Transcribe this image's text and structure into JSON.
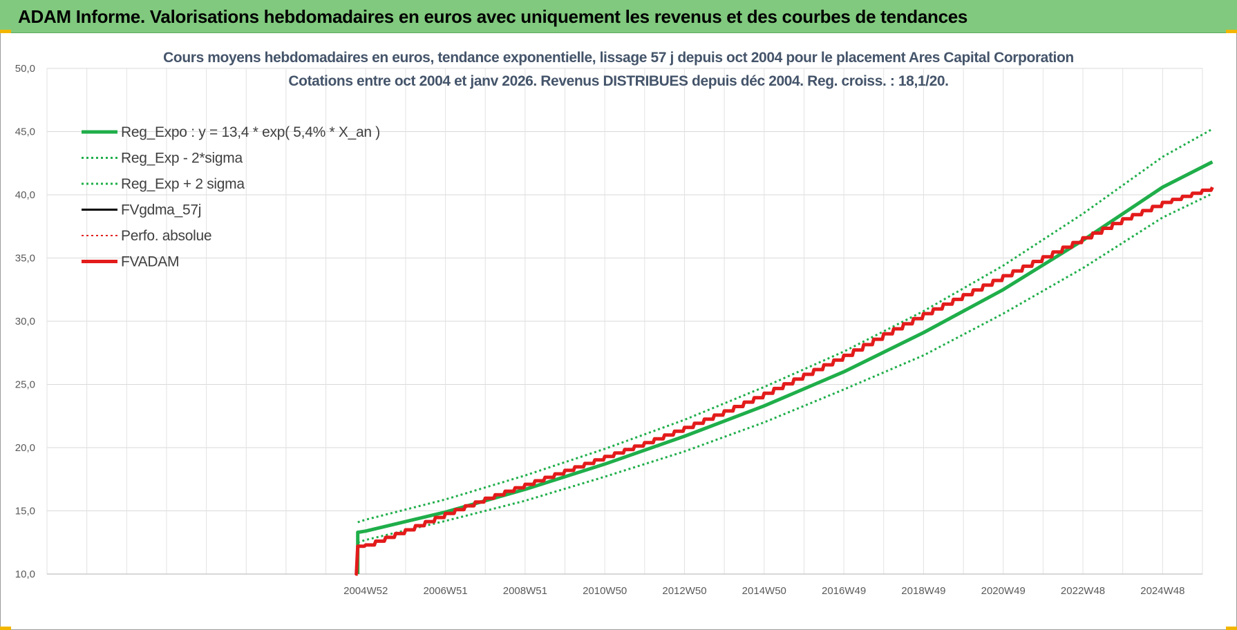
{
  "banner": {
    "title": "ADAM Informe. Valorisations hebdomadaires en euros avec uniquement les revenus et des courbes de tendances"
  },
  "chart_data": {
    "type": "line",
    "title_line1": "Cours moyens hebdomadaires en euros, tendance exponentielle, lissage 57 j depuis oct 2004 pour le placement Ares Capital Corporation",
    "title_line2": "Cotations entre oct 2004 et janv 2026. Revenus DISTRIBUES depuis déc 2004. Reg. croiss. : 18,1/20.",
    "xlabel": "",
    "ylabel": "",
    "ylim": [
      10,
      50
    ],
    "yticks": [
      10,
      15,
      20,
      25,
      30,
      35,
      40,
      45,
      50
    ],
    "ytick_labels": [
      "10,0",
      "15,0",
      "20,0",
      "25,0",
      "30,0",
      "35,0",
      "40,0",
      "45,0",
      "50,0"
    ],
    "x_category_count": 29,
    "x_tick_labels": [
      {
        "index": 8,
        "label": "2004W52"
      },
      {
        "index": 10,
        "label": "2006W51"
      },
      {
        "index": 12,
        "label": "2008W51"
      },
      {
        "index": 14,
        "label": "2010W50"
      },
      {
        "index": 16,
        "label": "2012W50"
      },
      {
        "index": 18,
        "label": "2014W50"
      },
      {
        "index": 20,
        "label": "2016W49"
      },
      {
        "index": 22,
        "label": "2018W49"
      },
      {
        "index": 24,
        "label": "2020W49"
      },
      {
        "index": 26,
        "label": "2022W48"
      },
      {
        "index": 28,
        "label": "2024W48"
      }
    ],
    "grid": true,
    "legend_position": "top-left",
    "series": [
      {
        "name": "Reg_Expo : y = 13,4 * exp( 5,4% *  X_an )",
        "color": "#1fae4a",
        "style": "solid-thick",
        "x": [
          7.8,
          7.8,
          8,
          10,
          12,
          14,
          16,
          18,
          20,
          22,
          24,
          26,
          28,
          29.25
        ],
        "y": [
          10,
          13.3,
          13.4,
          14.9,
          16.7,
          18.7,
          20.9,
          23.3,
          26.0,
          29.1,
          32.5,
          36.4,
          40.6,
          42.6
        ]
      },
      {
        "name": "Reg_Exp - 2*sigma",
        "color": "#1fae4a",
        "style": "dotted",
        "x": [
          7.8,
          8,
          10,
          12,
          14,
          16,
          18,
          20,
          22,
          24,
          26,
          28,
          29.25
        ],
        "y": [
          12.5,
          12.7,
          14.2,
          15.8,
          17.7,
          19.7,
          22.0,
          24.6,
          27.3,
          30.6,
          34.2,
          38.2,
          40.1
        ]
      },
      {
        "name": "Reg_Exp + 2 sigma",
        "color": "#1fae4a",
        "style": "dotted",
        "x": [
          7.8,
          8,
          10,
          12,
          14,
          16,
          18,
          20,
          22,
          24,
          26,
          28,
          29.25
        ],
        "y": [
          14.1,
          14.3,
          15.9,
          17.8,
          19.9,
          22.2,
          24.8,
          27.6,
          30.8,
          34.4,
          38.5,
          43.0,
          45.2
        ]
      },
      {
        "name": "FVgdma_57j",
        "color": "#000000",
        "style": "solid",
        "x": [],
        "y": []
      },
      {
        "name": "Perfo. absolue",
        "color": "#e31b1b",
        "style": "dotted",
        "x": [],
        "y": []
      },
      {
        "name": "FVADAM",
        "color": "#e31b1b",
        "style": "solid-thick-stepped",
        "x": [
          7.8,
          7.8,
          8,
          9,
          10,
          11,
          12,
          13,
          14,
          15,
          16,
          17,
          18,
          19,
          20,
          21,
          22,
          23,
          24,
          25,
          26,
          27,
          28,
          29.25
        ],
        "y": [
          10,
          12.2,
          12.3,
          13.5,
          14.8,
          16.0,
          17.1,
          18.2,
          19.3,
          20.4,
          21.6,
          22.9,
          24.3,
          25.8,
          27.3,
          29.0,
          30.6,
          32.1,
          33.6,
          35.1,
          36.6,
          38.1,
          39.4,
          40.6
        ]
      }
    ]
  }
}
